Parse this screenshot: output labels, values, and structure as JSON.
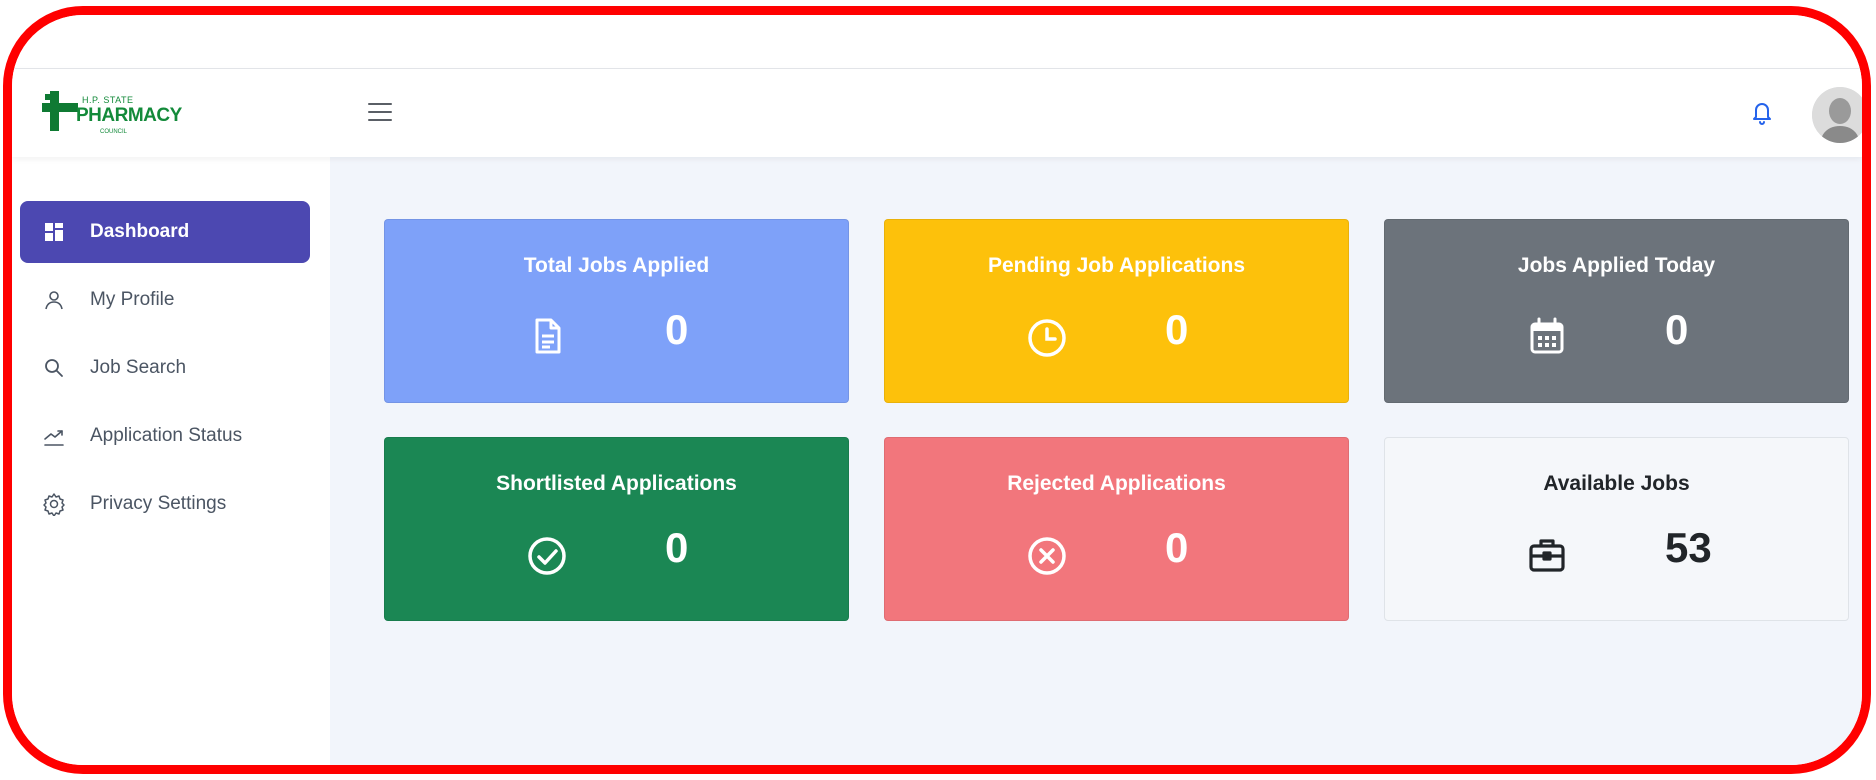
{
  "brand": {
    "logo_small": "H.P. STATE",
    "logo_big": "PHARMACY",
    "logo_tiny": "COUNCIL"
  },
  "sidebar": {
    "items": [
      {
        "label": "Dashboard",
        "icon": "dashboard-icon",
        "active": true
      },
      {
        "label": "My Profile",
        "icon": "user-icon",
        "active": false
      },
      {
        "label": "Job Search",
        "icon": "search-icon",
        "active": false
      },
      {
        "label": "Application Status",
        "icon": "trending-up-icon",
        "active": false
      },
      {
        "label": "Privacy Settings",
        "icon": "gear-icon",
        "active": false
      }
    ]
  },
  "cards": [
    {
      "title": "Total Jobs Applied",
      "value": "0",
      "icon": "document-icon",
      "bg": "#7ea1f9",
      "fg": "#ffffff"
    },
    {
      "title": "Pending Job Applications",
      "value": "0",
      "icon": "clock-icon",
      "bg": "#fdc10b",
      "fg": "#ffffff"
    },
    {
      "title": "Jobs Applied Today",
      "value": "0",
      "icon": "calendar-icon",
      "bg": "#6c737b",
      "fg": "#ffffff"
    },
    {
      "title": "Shortlisted Applications",
      "value": "0",
      "icon": "check-circle-icon",
      "bg": "#1b8754",
      "fg": "#ffffff"
    },
    {
      "title": "Rejected Applications",
      "value": "0",
      "icon": "x-circle-icon",
      "bg": "#f2767c",
      "fg": "#ffffff"
    },
    {
      "title": "Available Jobs",
      "value": "53",
      "icon": "briefcase-icon",
      "bg": "#f5f7fa",
      "fg": "#212529"
    }
  ],
  "colors": {
    "accent": "#4c48b1",
    "frame": "#ff0000",
    "bell": "#2563eb"
  }
}
